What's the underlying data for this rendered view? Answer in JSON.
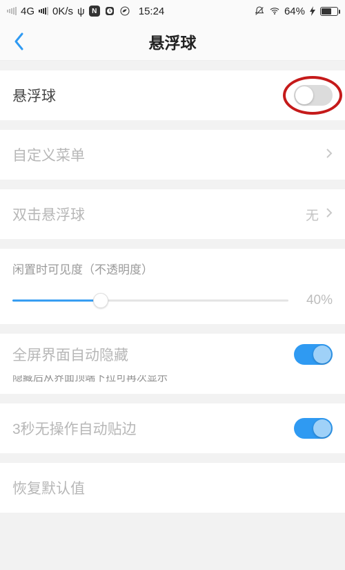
{
  "statusbar": {
    "net": "4G",
    "speed": "0K/s",
    "usb": "ψ",
    "time": "15:24",
    "battery_pct": "64%"
  },
  "header": {
    "title": "悬浮球"
  },
  "rows": {
    "floatball": {
      "label": "悬浮球",
      "enabled": false
    },
    "custom_menu": {
      "label": "自定义菜单"
    },
    "double_tap": {
      "label": "双击悬浮球",
      "value": "无"
    },
    "opacity": {
      "title": "闲置时可见度（不透明度）",
      "percent": "40%",
      "value_pct": 32
    },
    "fullscreen_hide": {
      "label": "全屏界面自动隐藏",
      "hint": "隐藏后从界面顶端下拉可再次显示",
      "enabled": true
    },
    "auto_edge": {
      "label": "3秒无操作自动贴边",
      "enabled": true
    },
    "reset": {
      "label": "恢复默认值"
    }
  }
}
